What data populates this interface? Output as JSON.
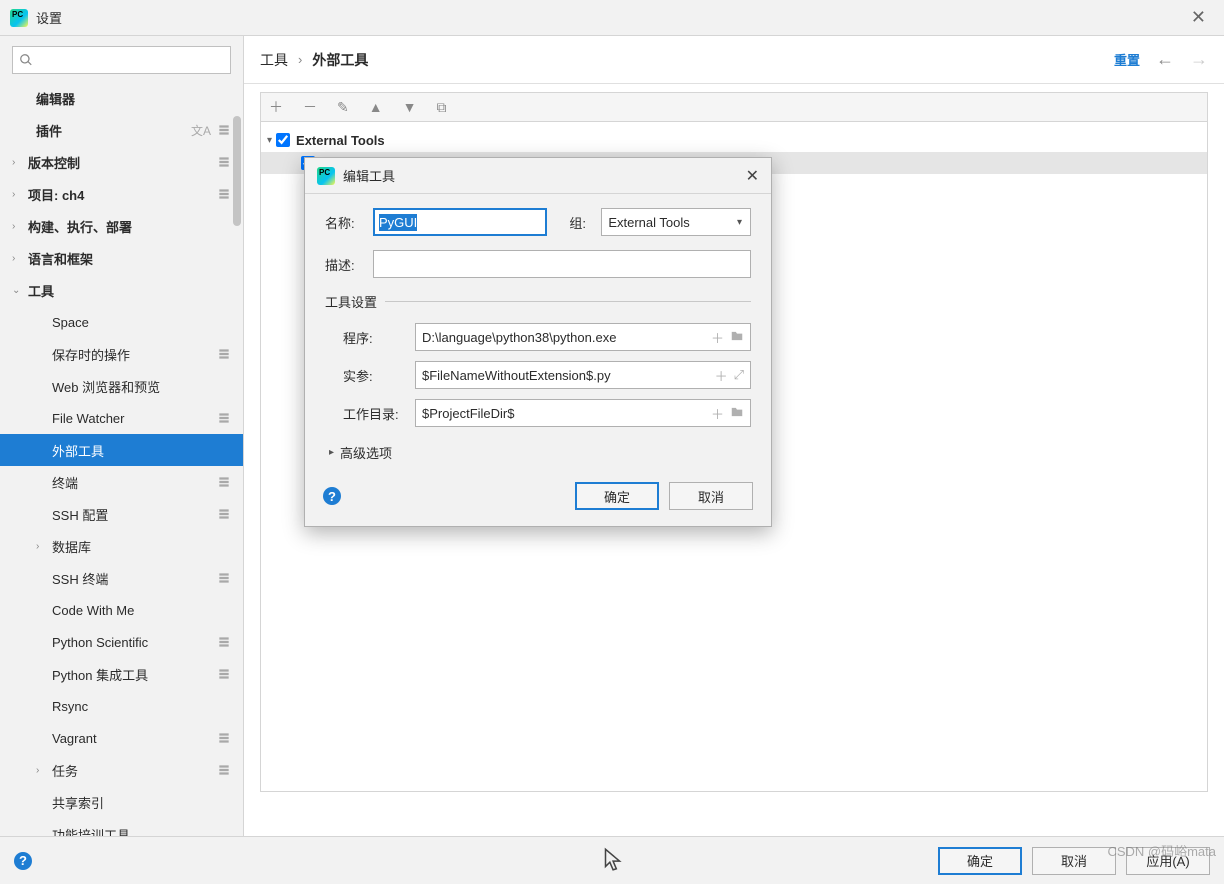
{
  "window": {
    "title": "设置"
  },
  "sidebar": {
    "search_placeholder": "",
    "items": [
      {
        "label": "编辑器",
        "bold": true,
        "chev": "",
        "level": 1,
        "lang": false,
        "config": false
      },
      {
        "label": "插件",
        "bold": true,
        "chev": "",
        "level": 1,
        "lang": true,
        "config": true
      },
      {
        "label": "版本控制",
        "bold": true,
        "chev": "›",
        "level": 0,
        "config": true
      },
      {
        "label": "项目: ch4",
        "bold": true,
        "chev": "›",
        "level": 0,
        "config": true
      },
      {
        "label": "构建、执行、部署",
        "bold": true,
        "chev": "›",
        "level": 0
      },
      {
        "label": "语言和框架",
        "bold": true,
        "chev": "›",
        "level": 0
      },
      {
        "label": "工具",
        "bold": true,
        "chev": "⌄",
        "level": 0
      },
      {
        "label": "Space",
        "chev": "",
        "level": 2
      },
      {
        "label": "保存时的操作",
        "chev": "",
        "level": 2,
        "config": true
      },
      {
        "label": "Web 浏览器和预览",
        "chev": "",
        "level": 2
      },
      {
        "label": "File Watcher",
        "chev": "",
        "level": 2,
        "config": true
      },
      {
        "label": "外部工具",
        "chev": "",
        "level": 2,
        "selected": true
      },
      {
        "label": "终端",
        "chev": "",
        "level": 2,
        "config": true
      },
      {
        "label": "SSH 配置",
        "chev": "",
        "level": 2,
        "config": true
      },
      {
        "label": "数据库",
        "chev": "›",
        "level": 1
      },
      {
        "label": "SSH 终端",
        "chev": "",
        "level": 2,
        "config": true
      },
      {
        "label": "Code With Me",
        "chev": "",
        "level": 2
      },
      {
        "label": "Python Scientific",
        "chev": "",
        "level": 2,
        "config": true
      },
      {
        "label": "Python 集成工具",
        "chev": "",
        "level": 2,
        "config": true
      },
      {
        "label": "Rsync",
        "chev": "",
        "level": 2
      },
      {
        "label": "Vagrant",
        "chev": "",
        "level": 2,
        "config": true
      },
      {
        "label": "任务",
        "chev": "›",
        "level": 1,
        "config": true
      },
      {
        "label": "共享索引",
        "chev": "",
        "level": 2
      },
      {
        "label": "功能培训工具",
        "chev": "",
        "level": 2
      }
    ]
  },
  "breadcrumb": {
    "root": "工具",
    "leaf": "外部工具",
    "reset": "重置"
  },
  "tree": {
    "group": "External Tools",
    "tool": ""
  },
  "dialog": {
    "title": "编辑工具",
    "labels": {
      "name": "名称:",
      "group": "组:",
      "desc": "描述:",
      "fieldset": "工具设置",
      "program": "程序:",
      "args": "实参:",
      "workdir": "工作目录:",
      "advanced": "高级选项"
    },
    "values": {
      "name": "PyGUI",
      "group": "External Tools",
      "desc": "",
      "program": "D:\\language\\python38\\python.exe",
      "args": "$FileNameWithoutExtension$.py",
      "workdir": "$ProjectFileDir$"
    },
    "buttons": {
      "ok": "确定",
      "cancel": "取消"
    }
  },
  "footer": {
    "ok": "确定",
    "cancel": "取消",
    "apply": "应用(A)"
  },
  "watermark": "CSDN @码峪mata"
}
